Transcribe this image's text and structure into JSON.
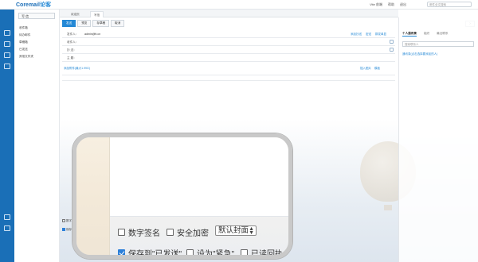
{
  "app": {
    "logo_brand": "Coremail",
    "logo_cn": "论客"
  },
  "topbar": {
    "links": [
      "Vite 前端",
      "帮助",
      "退出"
    ],
    "search_placeholder": "邮件全文搜索"
  },
  "nav": {
    "write_label": "写 信",
    "items": [
      "收件箱",
      "待办邮件",
      "草稿箱",
      "已发送",
      "其他文件夹"
    ]
  },
  "tabs": [
    {
      "label": "欢迎页"
    },
    {
      "label": "写信"
    }
  ],
  "toolbar": {
    "send": "发送",
    "preview": "预览",
    "save_draft": "存草稿",
    "cancel": "取消"
  },
  "compose_links": [
    "添加抄送",
    "密送",
    "群发单显"
  ],
  "fields": {
    "from_label": "发件人：",
    "from_value": "admin@tt.cn",
    "to_label": "收件人：",
    "cc_label": "抄 送：",
    "subject_label": "主 题："
  },
  "attach": {
    "label": "添加附件(最大1.99G)"
  },
  "right_links": [
    "插入图片",
    "模板"
  ],
  "right_panel": {
    "tabs": [
      "个人通讯录",
      "组织",
      "最近联系"
    ],
    "search_placeholder": "搜索联系人",
    "hint": "通讯录(点击选择要添加的人)"
  },
  "bottom_small": {
    "option1": "数字",
    "option2": "保存"
  },
  "magnifier": {
    "options": {
      "digital_signature": "数字签名",
      "encrypt": "安全加密",
      "cover_select": "默认封面",
      "save_to_sent": "保存到\"已发送\"",
      "set_urgent": "设为\"紧急\"",
      "read_receipt": "已读回执"
    },
    "checked": {
      "save_to_sent": true
    }
  }
}
